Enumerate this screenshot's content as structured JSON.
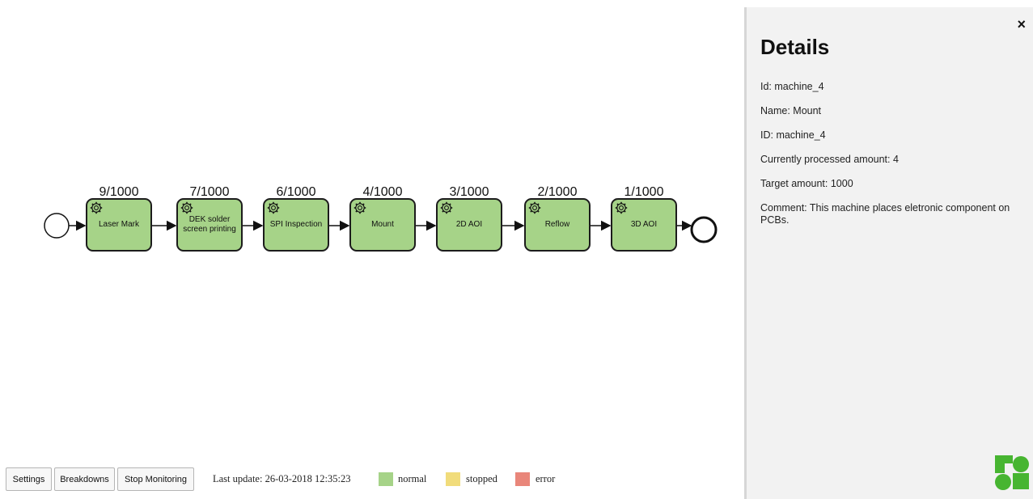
{
  "process": {
    "tasks": [
      {
        "label": "Laser Mark",
        "count": "9/1000"
      },
      {
        "label": "DEK solder screen printing",
        "count": "7/1000"
      },
      {
        "label": "SPI Inspection",
        "count": "6/1000"
      },
      {
        "label": "Mount",
        "count": "4/1000"
      },
      {
        "label": "2D AOI",
        "count": "3/1000"
      },
      {
        "label": "Reflow",
        "count": "2/1000"
      },
      {
        "label": "3D AOI",
        "count": "1/1000"
      }
    ],
    "status_color": "#a6d388"
  },
  "details": {
    "title": "Details",
    "close_label": "×",
    "fields": [
      "Id: machine_4",
      "Name: Mount",
      "ID: machine_4",
      "Currently processed amount: 4",
      "Target amount: 1000",
      "Comment: This machine places eletronic component on PCBs."
    ]
  },
  "toolbar": {
    "settings_label": "Settings",
    "breakdowns_label": "Breakdowns",
    "stop_label": "Stop Monitoring",
    "last_update": "Last update: 26-03-2018 12:35:23"
  },
  "legend": [
    {
      "label": "normal",
      "color": "#a6d388"
    },
    {
      "label": "stopped",
      "color": "#f1dc7b"
    },
    {
      "label": "error",
      "color": "#e9867a"
    }
  ]
}
